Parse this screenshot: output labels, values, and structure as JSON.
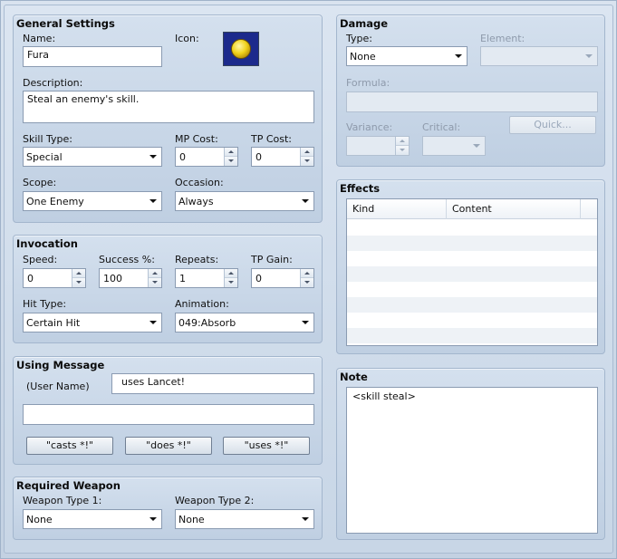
{
  "general": {
    "title": "General Settings",
    "name_label": "Name:",
    "name_value": "Fura",
    "icon_label": "Icon:",
    "icon_name": "gold-coin-icon",
    "description_label": "Description:",
    "description_value": "Steal an enemy's skill.",
    "skill_type_label": "Skill Type:",
    "skill_type_value": "Special",
    "mp_cost_label": "MP Cost:",
    "mp_cost_value": "0",
    "tp_cost_label": "TP Cost:",
    "tp_cost_value": "0",
    "scope_label": "Scope:",
    "scope_value": "One Enemy",
    "occasion_label": "Occasion:",
    "occasion_value": "Always"
  },
  "invocation": {
    "title": "Invocation",
    "speed_label": "Speed:",
    "speed_value": "0",
    "success_label": "Success %:",
    "success_value": "100",
    "repeats_label": "Repeats:",
    "repeats_value": "1",
    "tp_gain_label": "TP Gain:",
    "tp_gain_value": "0",
    "hit_type_label": "Hit Type:",
    "hit_type_value": "Certain Hit",
    "animation_label": "Animation:",
    "animation_value": "049:Absorb"
  },
  "message": {
    "title": "Using Message",
    "user_name_label": "(User Name)",
    "line1_value": "uses Lancet!",
    "line2_value": "",
    "casts_button": "\"casts *!\"",
    "does_button": "\"does *!\"",
    "uses_button": "\"uses *!\""
  },
  "weapon": {
    "title": "Required Weapon",
    "type1_label": "Weapon Type 1:",
    "type1_value": "None",
    "type2_label": "Weapon Type 2:",
    "type2_value": "None"
  },
  "damage": {
    "title": "Damage",
    "type_label": "Type:",
    "type_value": "None",
    "element_label": "Element:",
    "element_value": "",
    "formula_label": "Formula:",
    "formula_value": "",
    "variance_label": "Variance:",
    "variance_value": "",
    "critical_label": "Critical:",
    "critical_value": "",
    "quick_button": "Quick..."
  },
  "effects": {
    "title": "Effects",
    "columns": [
      "Kind",
      "Content"
    ]
  },
  "note": {
    "title": "Note",
    "value": "<skill steal>"
  }
}
